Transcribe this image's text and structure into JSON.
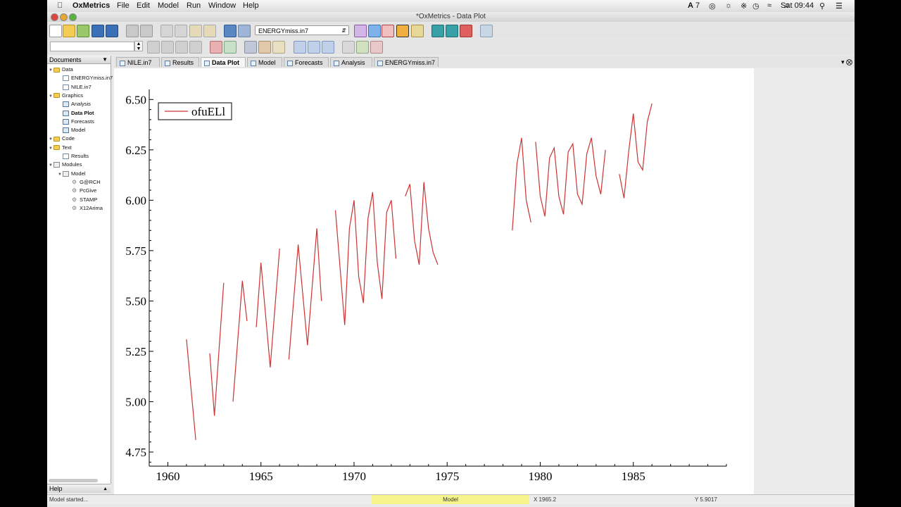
{
  "menubar": {
    "app_name": "OxMetrics",
    "items": [
      "File",
      "Edit",
      "Model",
      "Run",
      "Window",
      "Help"
    ],
    "status": {
      "battery_label": "7",
      "clock": "Sat 09:44"
    }
  },
  "window": {
    "title": "*OxMetrics - Data Plot"
  },
  "toolbar": {
    "file_select": "ENERGYmiss.in7"
  },
  "sidebar": {
    "header": "Documents",
    "tree": [
      {
        "label": "Data",
        "level": 0,
        "icon": "folder-icon",
        "bold": false
      },
      {
        "label": "ENERGYmiss.in7",
        "level": 1,
        "icon": "data-file-icon",
        "bold": false
      },
      {
        "label": "NILE.in7",
        "level": 1,
        "icon": "data-file-icon",
        "bold": false
      },
      {
        "label": "Graphics",
        "level": 0,
        "icon": "folder-icon",
        "bold": false
      },
      {
        "label": "Analysis",
        "level": 1,
        "icon": "graph-icon",
        "bold": false
      },
      {
        "label": "Data Plot",
        "level": 1,
        "icon": "graph-icon",
        "bold": true
      },
      {
        "label": "Forecasts",
        "level": 1,
        "icon": "graph-icon",
        "bold": false
      },
      {
        "label": "Model",
        "level": 1,
        "icon": "graph-icon",
        "bold": false
      },
      {
        "label": "Code",
        "level": 0,
        "icon": "folder-icon",
        "bold": false
      },
      {
        "label": "Text",
        "level": 0,
        "icon": "folder-icon",
        "bold": false
      },
      {
        "label": "Results",
        "level": 1,
        "icon": "text-file-icon",
        "bold": false
      },
      {
        "label": "Modules",
        "level": 0,
        "icon": "modules-icon",
        "bold": false
      },
      {
        "label": "Model",
        "level": 1,
        "icon": "model-icon",
        "bold": false
      },
      {
        "label": "G@RCH",
        "level": 2,
        "icon": "gear-icon",
        "bold": false
      },
      {
        "label": "PcGive",
        "level": 2,
        "icon": "gear-icon",
        "bold": false
      },
      {
        "label": "STAMP",
        "level": 2,
        "icon": "gear-icon",
        "bold": false
      },
      {
        "label": "X12Arima",
        "level": 2,
        "icon": "gear-icon",
        "bold": false
      }
    ],
    "help_label": "Help"
  },
  "tabs": [
    {
      "label": "NILE.in7",
      "active": false
    },
    {
      "label": "Results",
      "active": false
    },
    {
      "label": "Data Plot",
      "active": true
    },
    {
      "label": "Model",
      "active": false
    },
    {
      "label": "Forecasts",
      "active": false
    },
    {
      "label": "Analysis",
      "active": false
    },
    {
      "label": "ENERGYmiss.in7",
      "active": false
    }
  ],
  "chart_data": {
    "type": "line",
    "title": "",
    "xlabel": "",
    "ylabel": "",
    "xlim": [
      1959,
      1990
    ],
    "ylim": [
      4.68,
      6.55
    ],
    "x_ticks": [
      1960,
      1965,
      1970,
      1975,
      1980,
      1985
    ],
    "y_ticks": [
      4.75,
      5.0,
      5.25,
      5.5,
      5.75,
      6.0,
      6.25,
      6.5
    ],
    "y_tick_labels": [
      "4.75",
      "5.00",
      "5.25",
      "5.50",
      "5.75",
      "6.00",
      "6.25",
      "6.50"
    ],
    "grid": false,
    "legend_position": "top-left",
    "series": [
      {
        "name": "ofuELl",
        "color": "#cc3333",
        "segments": [
          [
            [
              1961.0,
              5.31
            ],
            [
              1961.5,
              4.81
            ]
          ],
          [
            [
              1962.25,
              5.24
            ],
            [
              1962.5,
              4.93
            ],
            [
              1963.0,
              5.59
            ]
          ],
          [
            [
              1963.5,
              5.0
            ],
            [
              1964.0,
              5.6
            ],
            [
              1964.25,
              5.4
            ]
          ],
          [
            [
              1964.75,
              5.37
            ],
            [
              1965.0,
              5.69
            ],
            [
              1965.5,
              5.17
            ],
            [
              1966.0,
              5.76
            ]
          ],
          [
            [
              1966.5,
              5.21
            ],
            [
              1967.0,
              5.78
            ],
            [
              1967.5,
              5.28
            ],
            [
              1968.0,
              5.86
            ],
            [
              1968.25,
              5.5
            ]
          ],
          [
            [
              1969.0,
              5.95
            ],
            [
              1969.5,
              5.38
            ],
            [
              1969.75,
              5.86
            ],
            [
              1970.0,
              6.0
            ],
            [
              1970.25,
              5.62
            ],
            [
              1970.5,
              5.49
            ],
            [
              1970.75,
              5.91
            ],
            [
              1971.0,
              6.04
            ],
            [
              1971.25,
              5.69
            ],
            [
              1971.5,
              5.51
            ],
            [
              1971.75,
              5.94
            ],
            [
              1972.0,
              6.0
            ],
            [
              1972.25,
              5.71
            ]
          ],
          [
            [
              1972.75,
              6.02
            ],
            [
              1973.0,
              6.08
            ],
            [
              1973.25,
              5.8
            ],
            [
              1973.5,
              5.68
            ],
            [
              1973.75,
              6.09
            ],
            [
              1974.0,
              5.86
            ],
            [
              1974.25,
              5.74
            ],
            [
              1974.5,
              5.68
            ]
          ],
          [
            [
              1978.5,
              5.85
            ],
            [
              1978.75,
              6.18
            ],
            [
              1979.0,
              6.31
            ],
            [
              1979.25,
              6.0
            ],
            [
              1979.5,
              5.89
            ]
          ],
          [
            [
              1979.75,
              6.29
            ],
            [
              1980.0,
              6.02
            ],
            [
              1980.25,
              5.92
            ],
            [
              1980.5,
              6.21
            ],
            [
              1980.75,
              6.26
            ],
            [
              1981.0,
              6.02
            ],
            [
              1981.25,
              5.93
            ],
            [
              1981.5,
              6.24
            ],
            [
              1981.75,
              6.28
            ],
            [
              1982.0,
              6.03
            ],
            [
              1982.25,
              5.98
            ],
            [
              1982.5,
              6.23
            ],
            [
              1982.75,
              6.31
            ],
            [
              1983.0,
              6.12
            ],
            [
              1983.25,
              6.03
            ],
            [
              1983.5,
              6.25
            ]
          ],
          [
            [
              1984.25,
              6.13
            ],
            [
              1984.5,
              6.01
            ],
            [
              1984.75,
              6.24
            ],
            [
              1985.0,
              6.43
            ],
            [
              1985.25,
              6.19
            ],
            [
              1985.5,
              6.15
            ],
            [
              1985.75,
              6.39
            ],
            [
              1986.0,
              6.48
            ]
          ]
        ]
      }
    ]
  },
  "statusbar": {
    "message": "Model started...",
    "module": "Model",
    "x_readout": "X 1965.2",
    "y_readout": "Y 5.9017"
  }
}
